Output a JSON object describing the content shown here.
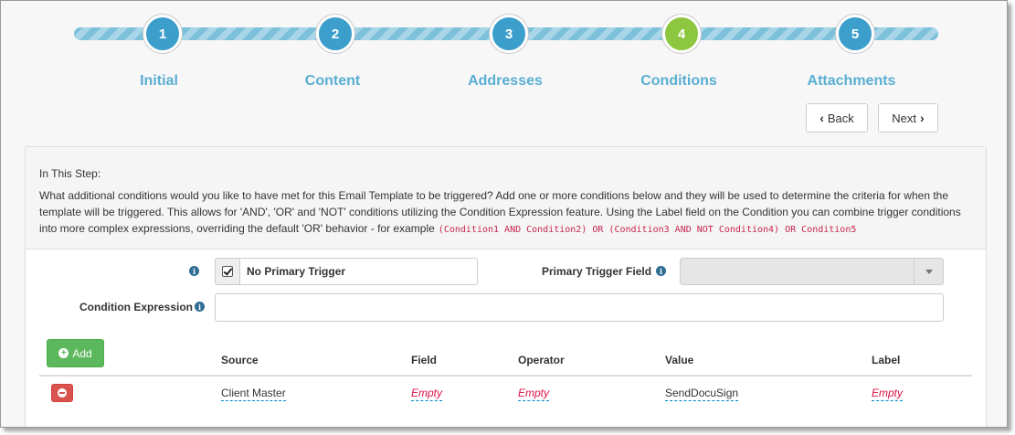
{
  "wizard": {
    "steps": [
      {
        "number": "1",
        "label": "Initial"
      },
      {
        "number": "2",
        "label": "Content"
      },
      {
        "number": "3",
        "label": "Addresses"
      },
      {
        "number": "4",
        "label": "Conditions"
      },
      {
        "number": "5",
        "label": "Attachments"
      }
    ],
    "active_step": 4,
    "back_label": "Back",
    "next_label": "Next"
  },
  "help": {
    "heading": "In This Step:",
    "body": "What additional conditions would you like to have met for this Email Template to be triggered? Add one or more conditions below and they will be used to determine the criteria for when the template will be triggered. This allows for 'AND', 'OR' and 'NOT' conditions utilizing the Condition Expression feature. Using the Label field on the Condition you can combine trigger conditions into more complex expressions, overriding the default 'OR' behavior - for example",
    "example": "(Condition1 AND Condition2) OR (Condition3 AND NOT Condition4) OR Condition5"
  },
  "form": {
    "no_primary_trigger_label": "No Primary Trigger",
    "no_primary_trigger_checked": true,
    "primary_trigger_field_label": "Primary Trigger Field",
    "primary_trigger_field_value": "",
    "condition_expression_label": "Condition Expression",
    "condition_expression_value": ""
  },
  "table": {
    "add_label": "Add",
    "columns": [
      "Source",
      "Field",
      "Operator",
      "Value",
      "Label"
    ],
    "rows": [
      {
        "source": "Client Master",
        "field": "Empty",
        "operator": "Empty",
        "value": "SendDocuSign",
        "label": "Empty"
      }
    ]
  },
  "colors": {
    "wizard_circle": "#3c9ecb",
    "wizard_active": "#8dc63f",
    "step_label": "#5aaed3",
    "add_button": "#5cb85c",
    "remove_button": "#d9534f",
    "empty_value": "#dd1144"
  },
  "icons": {
    "info": "info-circle-icon",
    "add": "plus-circle-icon",
    "remove": "minus-circle-icon",
    "back": "chevron-left-icon",
    "next": "chevron-right-icon",
    "dropdown": "caret-down-icon"
  }
}
